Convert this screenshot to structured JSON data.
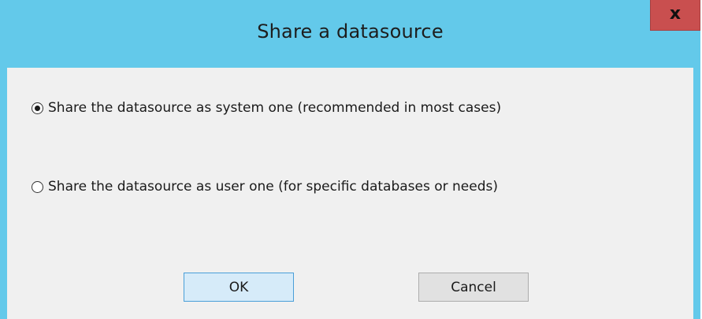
{
  "window": {
    "title": "Share a datasource",
    "close_glyph": "x",
    "title_bar_color": "#63c9ea",
    "close_button_color": "#c94f4f"
  },
  "options": [
    {
      "label": "Share the datasource as system one (recommended in most cases)",
      "checked": true
    },
    {
      "label": "Share the datasource as user one (for specific databases or needs)",
      "checked": false
    }
  ],
  "buttons": {
    "ok_label": "OK",
    "cancel_label": "Cancel"
  }
}
